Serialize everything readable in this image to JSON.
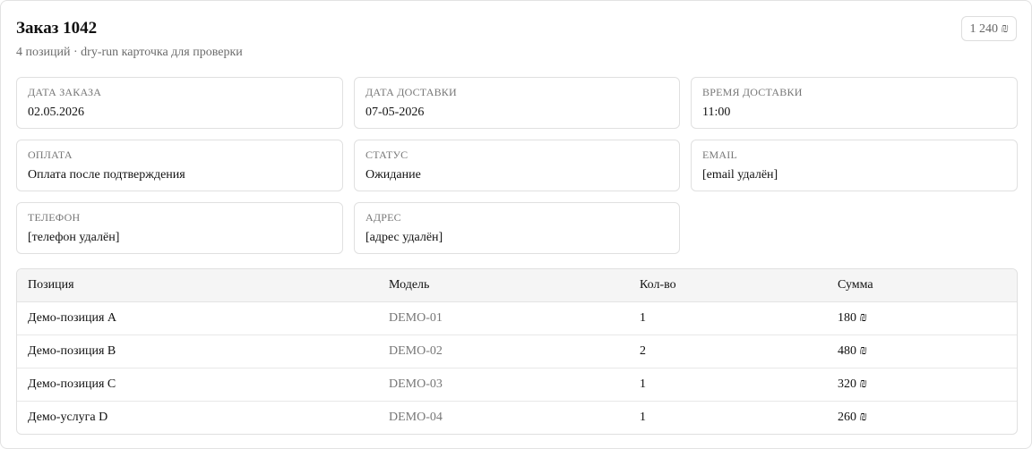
{
  "order": {
    "title": "Заказ 1042",
    "subtitle": "4 позиций · dry-run карточка для проверки",
    "total": "1 240 ₪"
  },
  "fields": [
    {
      "label": "Дата заказа",
      "value": "02.05.2026"
    },
    {
      "label": "Дата доставки",
      "value": "07-05-2026"
    },
    {
      "label": "Время доставки",
      "value": "11:00"
    },
    {
      "label": "Оплата",
      "value": "Оплата после подтверждения"
    },
    {
      "label": "Статус",
      "value": "Ожидание"
    },
    {
      "label": "Email",
      "value": "[email удалён]"
    },
    {
      "label": "Телефон",
      "value": "[телефон удалён]"
    },
    {
      "label": "Адрес",
      "value": "[адрес удалён]"
    }
  ],
  "items_table": {
    "columns": [
      "Позиция",
      "Модель",
      "Кол-во",
      "Сумма"
    ],
    "rows": [
      {
        "name": "Демо-позиция A",
        "model": "DEMO-01",
        "qty": "1",
        "sum": "180 ₪"
      },
      {
        "name": "Демо-позиция B",
        "model": "DEMO-02",
        "qty": "2",
        "sum": "480 ₪"
      },
      {
        "name": "Демо-позиция C",
        "model": "DEMO-03",
        "qty": "1",
        "sum": "320 ₪"
      },
      {
        "name": "Демо-услуга D",
        "model": "DEMO-04",
        "qty": "1",
        "sum": "260 ₪"
      }
    ]
  },
  "colors": {
    "border": "#e0e0e0",
    "header_bg": "#f5f5f5",
    "muted_text": "#777777",
    "text": "#111111"
  }
}
